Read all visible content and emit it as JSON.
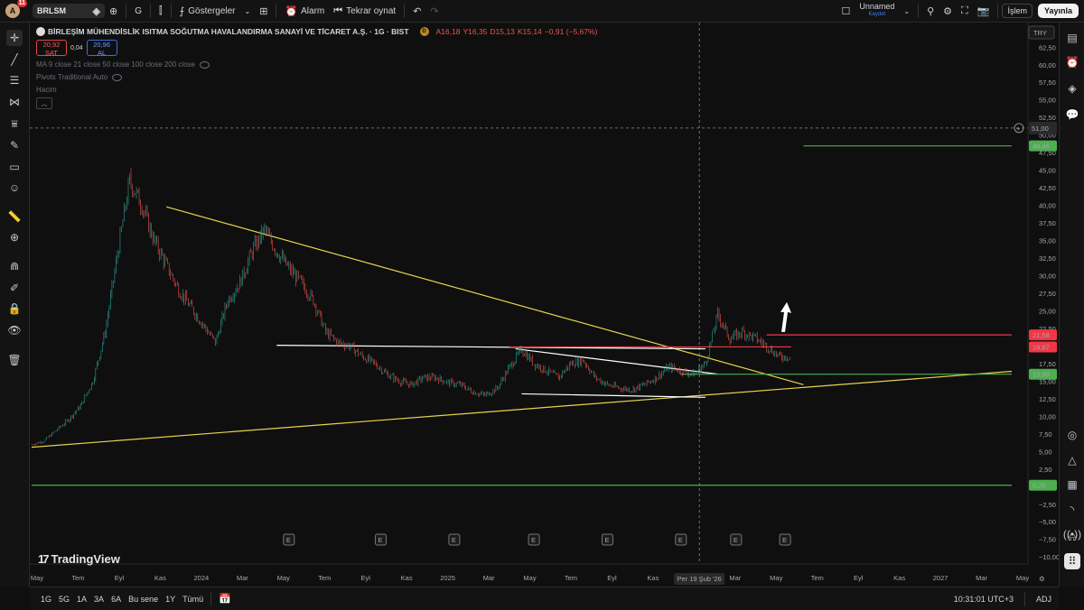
{
  "topbar": {
    "avatar_letter": "A",
    "notif_count": "11",
    "symbol": "BRLSM",
    "interval": "G",
    "indicators_label": "Göstergeler",
    "alarm_label": "Alarm",
    "replay_label": "Tekrar oynat",
    "layout_name": "Unnamed",
    "layout_status": "Kaydet",
    "trade_label": "İşlem",
    "publish_label": "Yayınla"
  },
  "legend": {
    "title": "BİRLEŞİM MÜHENDİSLİK ISITMA SOĞUTMA HAVALANDIRMA SANAYİ VE TİCARET A.Ş. · 1G · BIST",
    "badge": "D",
    "o": "A16,18",
    "h": "Y16,35",
    "l": "D15,13",
    "c": "K15,14",
    "chg": "−0,91 (−5,67%)",
    "sell_price": "20,92",
    "sell_label": "SAT",
    "spread": "0,04",
    "buy_price": "20,96",
    "buy_label": "AL",
    "ma_line": "MA 9 close 21 close 50 close 100 close 200 close",
    "pivots_line": "Pivots Traditional Auto",
    "volume_line": "Hacim"
  },
  "watermark": "TradingView",
  "currency": "TRY",
  "crosshair_price": "51,00",
  "crosshair_date": "Per 19 Şub '26",
  "colors": {
    "up": "#26a69a",
    "down": "#ef5350",
    "bg": "#0f0f0f",
    "yellow": "#e8d44d",
    "red_line": "#f23645",
    "green_line": "#4caf50"
  },
  "price_labels": [
    {
      "value": 48.46,
      "text": "48,46",
      "color": "#4caf50"
    },
    {
      "value": 21.58,
      "text": "21,58",
      "color": "#f23645"
    },
    {
      "value": 19.87,
      "text": "19,87",
      "color": "#f23645"
    },
    {
      "value": 15.99,
      "text": "15,99",
      "color": "#4caf50"
    },
    {
      "value": 0.2,
      "text": "0,20",
      "color": "#4caf50"
    }
  ],
  "chart_data": {
    "type": "line",
    "symbol": "BRLSM",
    "ylim": [
      -11,
      66
    ],
    "y_ticks": [
      "62,50",
      "60,00",
      "57,50",
      "55,00",
      "52,50",
      "50,00",
      "47,50",
      "45,00",
      "42,50",
      "40,00",
      "37,50",
      "35,00",
      "32,50",
      "30,00",
      "27,50",
      "25,00",
      "22,50",
      "20,00",
      "17,50",
      "15,00",
      "12,50",
      "10,00",
      "7,50",
      "5,00",
      "2,50",
      "0,00",
      "−2,50",
      "−5,00",
      "−7,50",
      "−10,00"
    ],
    "x_ticks": [
      "May",
      "Tem",
      "Eyl",
      "Kas",
      "2024",
      "Mar",
      "May",
      "Tem",
      "Eyl",
      "Kas",
      "2025",
      "Mar",
      "May",
      "Tem",
      "Eyl",
      "Kas",
      "2026",
      "Mar",
      "May",
      "Tem",
      "Eyl",
      "Kas",
      "2027",
      "Mar",
      "May"
    ],
    "series": [
      {
        "values": [
          6.0,
          6.5,
          8.0,
          9.5,
          11.5,
          15.0,
          22.0,
          33.0,
          43.5,
          40.0,
          35.0,
          31.5,
          28.0,
          25.5,
          23.0,
          20.5,
          26.5,
          29.0,
          33.5,
          36.5,
          33.5,
          31.0,
          29.0,
          26.5,
          22.0,
          20.5,
          20.0,
          18.5,
          17.5,
          16.0,
          15.0,
          14.5,
          15.5,
          15.5,
          14.8,
          14.5,
          13.5,
          13.0,
          14.0,
          17.0,
          19.5,
          17.5,
          16.5,
          15.5,
          17.5,
          18.0,
          15.5,
          14.5,
          14.0,
          13.8,
          14.5,
          15.5,
          17.0,
          16.5,
          16.0,
          17.5,
          24.5,
          21.0,
          22.0,
          21.2,
          20.0,
          18.5
        ]
      }
    ],
    "annotation_lines": [
      {
        "color": "#e8d44d",
        "from": [
          0,
          5.6
        ],
        "to": [
          80,
          16.4
        ]
      },
      {
        "color": "#e8d44d",
        "from": [
          11,
          39.8
        ],
        "to": [
          63,
          14.5
        ]
      },
      {
        "color": "#ffffff",
        "from": [
          20,
          20.1
        ],
        "to": [
          55,
          19.6
        ]
      },
      {
        "color": "#ffffff",
        "from": [
          39.5,
          19.6
        ],
        "to": [
          56,
          16.0
        ]
      },
      {
        "color": "#ffffff",
        "from": [
          40,
          13.2
        ],
        "to": [
          55,
          12.7
        ]
      },
      {
        "color": "#f23645",
        "from": [
          39,
          19.87
        ],
        "to": [
          62,
          19.87
        ]
      },
      {
        "color": "#f23645",
        "from": [
          60,
          21.58
        ],
        "to": [
          80,
          21.58
        ]
      },
      {
        "color": "#4caf50",
        "from": [
          53,
          15.99
        ],
        "to": [
          80,
          15.99
        ]
      },
      {
        "color": "#4caf50",
        "from": [
          63,
          48.46
        ],
        "to": [
          80,
          48.46
        ]
      },
      {
        "color": "#4caf50",
        "from": [
          0,
          0.2
        ],
        "to": [
          80,
          0.2
        ]
      }
    ]
  },
  "time_axis": {
    "months": [
      "May",
      "Tem",
      "Eyl",
      "Kas",
      "2024",
      "Mar",
      "May",
      "Tem",
      "Eyl",
      "Kas",
      "2025",
      "Mar",
      "May",
      "Tem",
      "Eyl",
      "Kas",
      "2026",
      "Mar",
      "May",
      "Tem",
      "Eyl",
      "Kas",
      "2027",
      "Mar",
      "May"
    ]
  },
  "bottombar": {
    "ranges": [
      "1G",
      "5G",
      "1A",
      "3A",
      "6A",
      "Bu sene",
      "1Y",
      "Tümü"
    ],
    "clock": "10:31:01 UTC+3",
    "adj": "ADJ"
  }
}
